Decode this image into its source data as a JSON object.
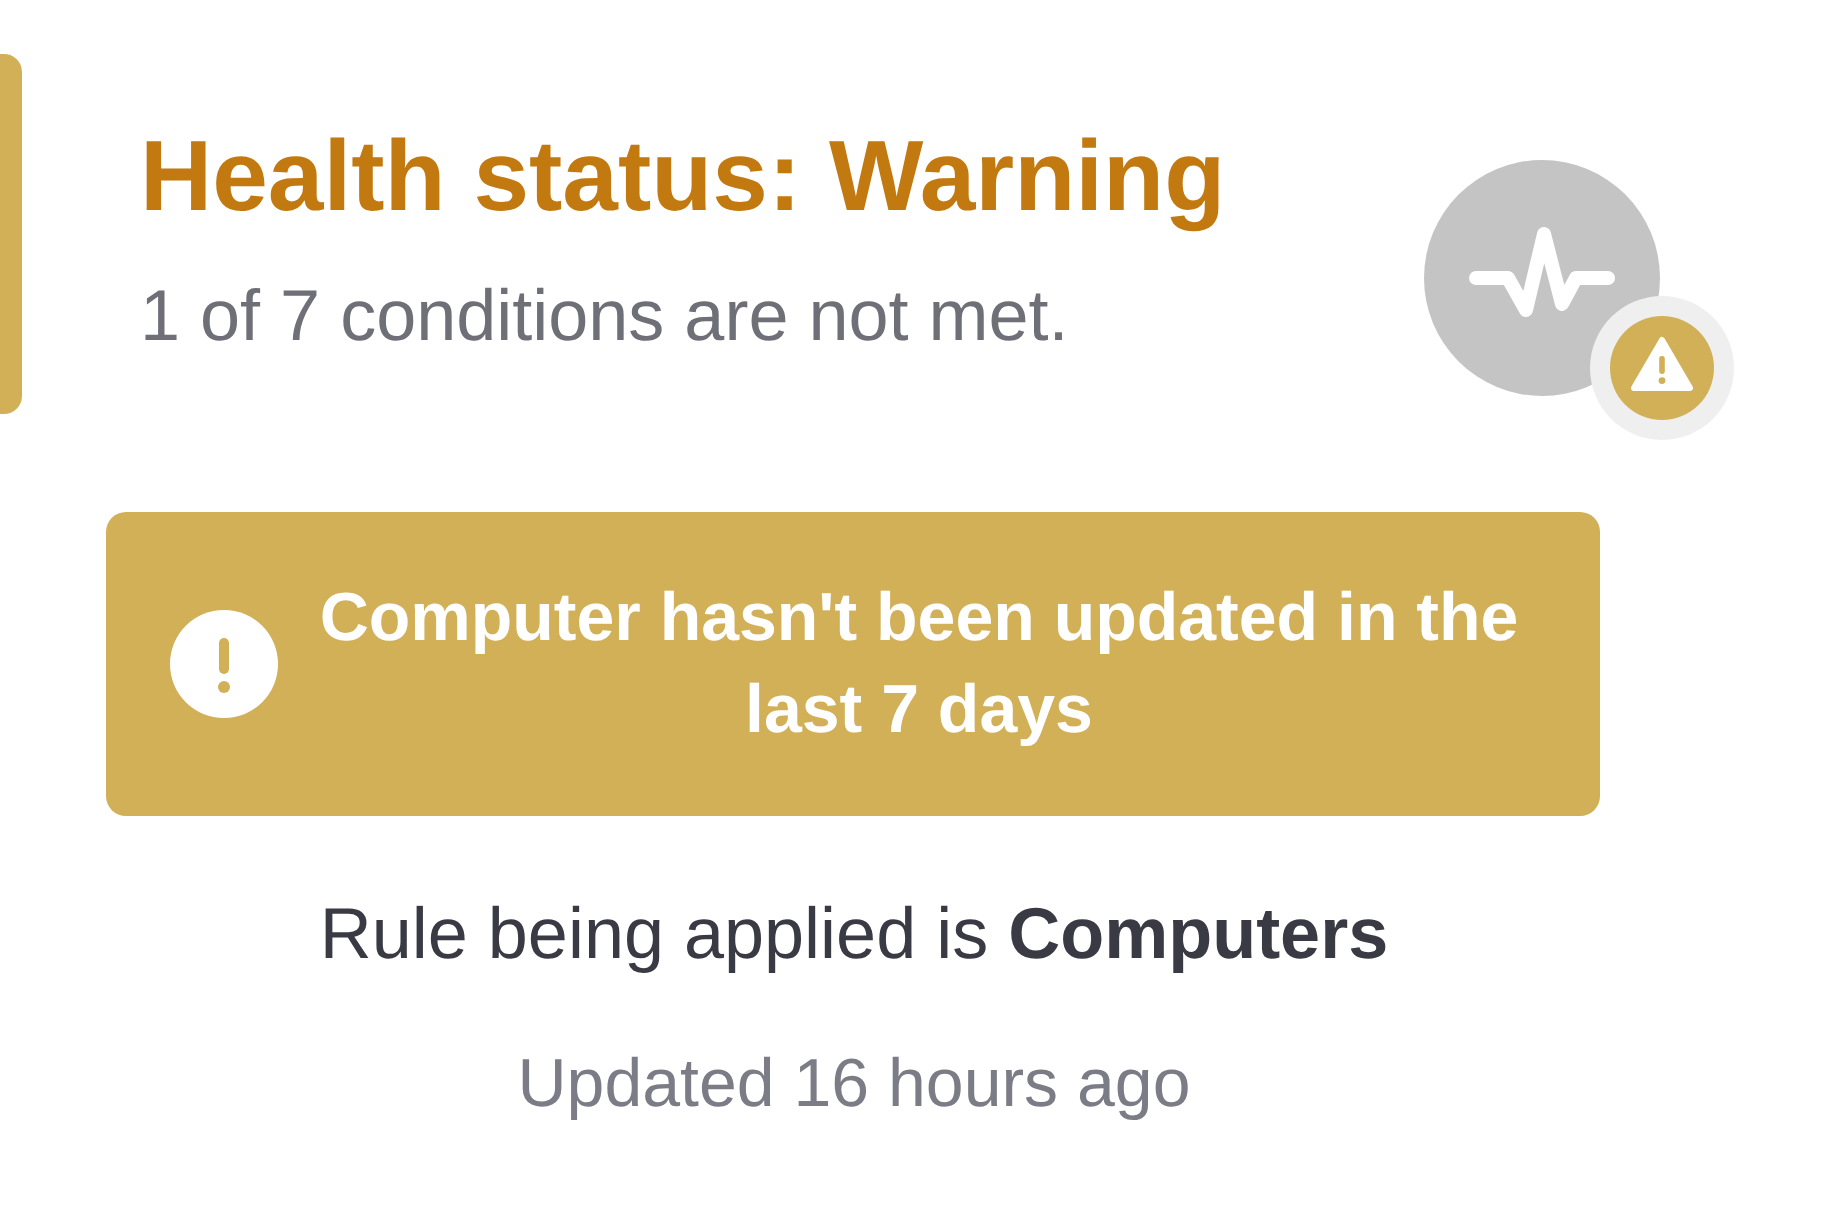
{
  "header": {
    "title": "Health status: Warning",
    "subtitle": "1 of 7 conditions are not met.",
    "kind": "warning"
  },
  "alert": {
    "message": "Computer hasn't been updated in the last 7 days"
  },
  "rule": "Rule being applied is **Computers**",
  "updated": "Updated 16 hours ago"
}
